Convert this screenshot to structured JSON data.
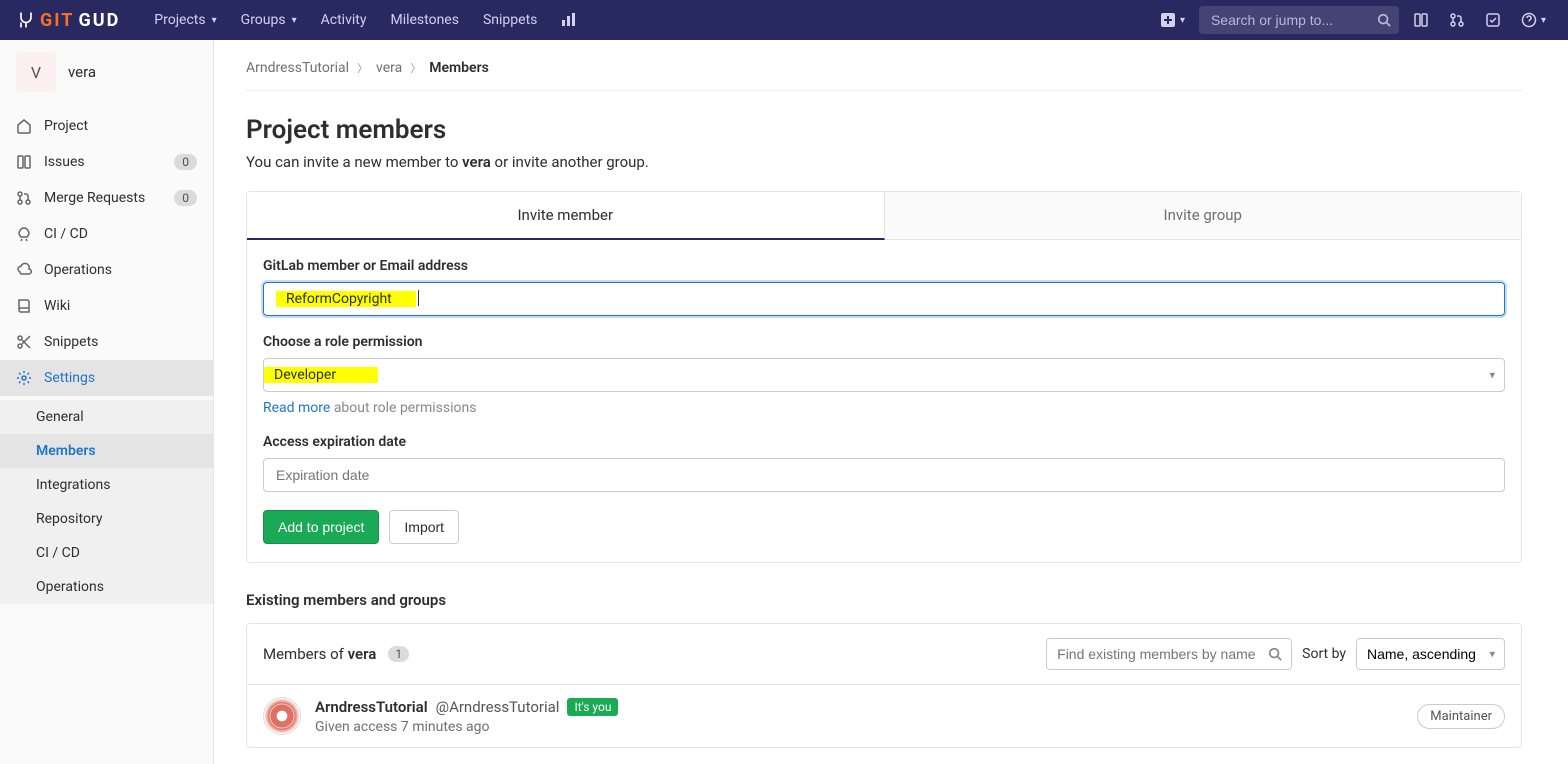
{
  "topnav": {
    "logo_git": "GIT",
    "logo_gud": "GUD",
    "menu": [
      "Projects",
      "Groups",
      "Activity",
      "Milestones",
      "Snippets"
    ],
    "search_placeholder": "Search or jump to..."
  },
  "sidebar": {
    "project_letter": "V",
    "project_name": "vera",
    "items": [
      {
        "label": "Project"
      },
      {
        "label": "Issues",
        "badge": "0"
      },
      {
        "label": "Merge Requests",
        "badge": "0"
      },
      {
        "label": "CI / CD"
      },
      {
        "label": "Operations"
      },
      {
        "label": "Wiki"
      },
      {
        "label": "Snippets"
      },
      {
        "label": "Settings"
      }
    ],
    "sub": [
      "General",
      "Members",
      "Integrations",
      "Repository",
      "CI / CD",
      "Operations"
    ]
  },
  "breadcrumbs": {
    "root": "ArndressTutorial",
    "project": "vera",
    "current": "Members"
  },
  "page": {
    "title": "Project members",
    "desc_pre": "You can invite a new member to ",
    "desc_bold": "vera",
    "desc_post": " or invite another group."
  },
  "tabs": {
    "member": "Invite member",
    "group": "Invite group"
  },
  "form": {
    "member_label": "GitLab member or Email address",
    "member_value": "ReformCopyright",
    "role_label": "Choose a role permission",
    "role_value": "Developer",
    "read_more": "Read more",
    "about_roles": " about role permissions",
    "expiry_label": "Access expiration date",
    "expiry_placeholder": "Expiration date",
    "add_btn": "Add to project",
    "import_btn": "Import"
  },
  "existing": {
    "title": "Existing members and groups",
    "members_of": "Members of ",
    "project": "vera",
    "count": "1",
    "find_placeholder": "Find existing members by name",
    "sortby": "Sort by",
    "sort_value": "Name, ascending",
    "member": {
      "name": "ArndressTutorial",
      "handle": "@ArndressTutorial",
      "you": "It's you",
      "access": "Given access 7 minutes ago",
      "role": "Maintainer"
    }
  }
}
